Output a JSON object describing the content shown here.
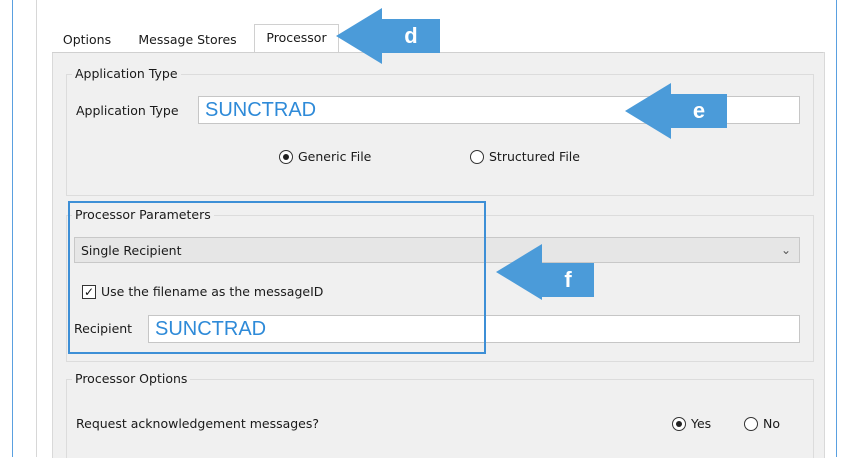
{
  "tabs": [
    {
      "label": "Options"
    },
    {
      "label": "Message Stores"
    },
    {
      "label": "Processor"
    }
  ],
  "application_type_group": {
    "title": "Application Type",
    "field_label": "Application Type",
    "field_value": "SUNCTRAD",
    "radio_generic": "Generic File",
    "radio_structured": "Structured File",
    "selected": "Generic File"
  },
  "processor_parameters": {
    "title": "Processor Parameters",
    "dropdown_value": "Single Recipient",
    "checkbox_label": "Use the filename as the messageID",
    "checkbox_checked": true,
    "recipient_label": "Recipient",
    "recipient_value": "SUNCTRAD"
  },
  "processor_options": {
    "title": "Processor Options",
    "question": "Request acknowledgement messages?",
    "yes_label": "Yes",
    "no_label": "No",
    "selected": "Yes"
  },
  "callouts": {
    "d": "d",
    "e": "e",
    "f": "f"
  },
  "colors": {
    "callout": "#4b9bd9",
    "field_text": "#2e8ad8",
    "highlight": "#3d8fd6"
  }
}
